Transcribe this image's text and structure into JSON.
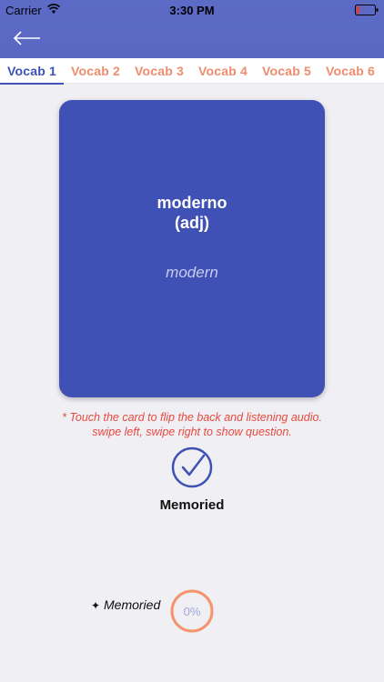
{
  "status_bar": {
    "carrier": "Carrier",
    "time": "3:30 PM"
  },
  "tabs": [
    {
      "label": "Vocab 1",
      "active": true
    },
    {
      "label": "Vocab 2",
      "active": false
    },
    {
      "label": "Vocab 3",
      "active": false
    },
    {
      "label": "Vocab 4",
      "active": false
    },
    {
      "label": "Vocab 5",
      "active": false
    },
    {
      "label": "Vocab 6",
      "active": false
    }
  ],
  "card": {
    "word": "moderno",
    "part_of_speech": "(adj)",
    "meaning": "modern"
  },
  "hint": {
    "line1": "* Touch the card to flip the back and listening audio.",
    "line2": "swipe left, swipe right to show question."
  },
  "memorize": {
    "label": "Memoried"
  },
  "progress": {
    "label": "Memoried",
    "value_text": "0%",
    "fraction": 0
  },
  "icons": {
    "back": "arrow-left-icon",
    "wifi": "wifi-icon",
    "battery": "battery-icon",
    "check": "check-circle-icon",
    "sparkle": "sparkle-icon"
  },
  "colors": {
    "header": "#5c6bc6",
    "card": "#3f51b5",
    "tab_active": "#3f51b5",
    "tab_inactive": "#f08c6e",
    "hint": "#e8493c",
    "progress_ring": "#f4936c",
    "battery": "#e53935"
  }
}
